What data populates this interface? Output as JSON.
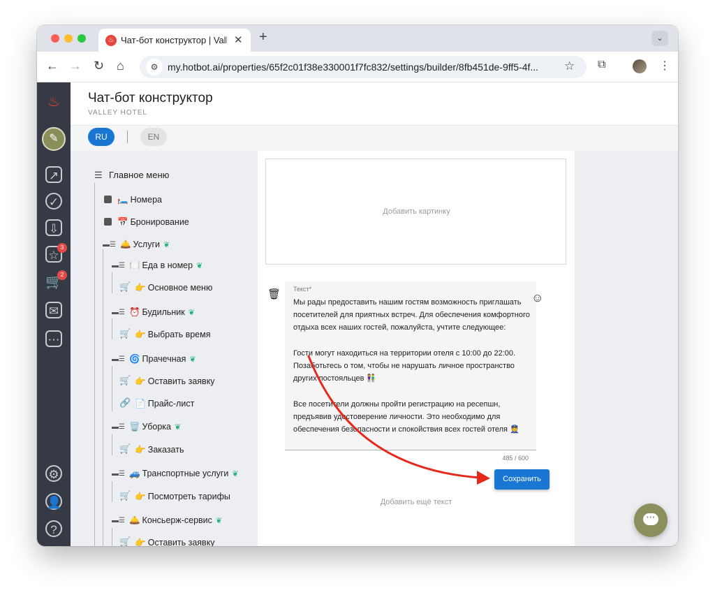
{
  "browser": {
    "tab_title": "Чат-бот конструктор | Valley Hotel",
    "url": "my.hotbot.ai/properties/65f2c01f38e330001f7fc832/settings/builder/8fb451de-9ff5-4f..."
  },
  "header": {
    "title": "Чат-бот конструктор",
    "subtitle": "VALLEY HOTEL"
  },
  "languages": {
    "ru": "RU",
    "en": "EN"
  },
  "rail": {
    "badge_reviews": "3",
    "badge_cart": "2"
  },
  "tree": {
    "root": "Главное меню",
    "items": [
      {
        "label": "Номера",
        "emoji": "🛏️"
      },
      {
        "label": "Бронирование",
        "emoji": "📅"
      },
      {
        "label": "Услуги",
        "emoji": "🛎️"
      },
      {
        "label": "Еда в номер",
        "emoji": "🍽️"
      },
      {
        "label": "Основное меню",
        "emoji": "👉"
      },
      {
        "label": "Будильник",
        "emoji": "⏰"
      },
      {
        "label": "Выбрать время",
        "emoji": "👉"
      },
      {
        "label": "Прачечная",
        "emoji": "🌀"
      },
      {
        "label": "Оставить заявку",
        "emoji": "👉"
      },
      {
        "label": "Прайс-лист",
        "emoji": "📄"
      },
      {
        "label": "Уборка",
        "emoji": "🗑️"
      },
      {
        "label": "Заказать",
        "emoji": "👉"
      },
      {
        "label": "Транспортные услуги",
        "emoji": "🚙"
      },
      {
        "label": "Посмотреть тарифы",
        "emoji": "👉"
      },
      {
        "label": "Консьерж-сервис",
        "emoji": "🛎️"
      },
      {
        "label": "Оставить заявку",
        "emoji": "👉"
      }
    ]
  },
  "editor": {
    "add_image": "Добавить картинку",
    "text_label": "Текст*",
    "text_value": "Мы рады предоставить нашим гостям возможность приглашать посетителей для приятных встреч. Для обеспечения комфортного отдыха всех наших гостей, пожалуйста, учтите следующее:\n\nГости могут находиться на территории отеля с 10:00 до 22:00. Позаботьтесь о том, чтобы не нарушать личное пространство других постояльцев 👫\n\nВсе посетители должны пройти регистрацию на ресепшн, предъявив удостоверение личности. Это необходимо для обеспечения безопасности и спокойствия всех гостей отеля 👮",
    "counter": "485 / 600",
    "save_label": "Сохранить",
    "add_text": "Добавить ещё текст"
  },
  "colors": {
    "primary": "#1976d2",
    "rail": "#353a44",
    "annotation_arrow": "#e5291b",
    "leaf_icon": "#22b07d"
  }
}
